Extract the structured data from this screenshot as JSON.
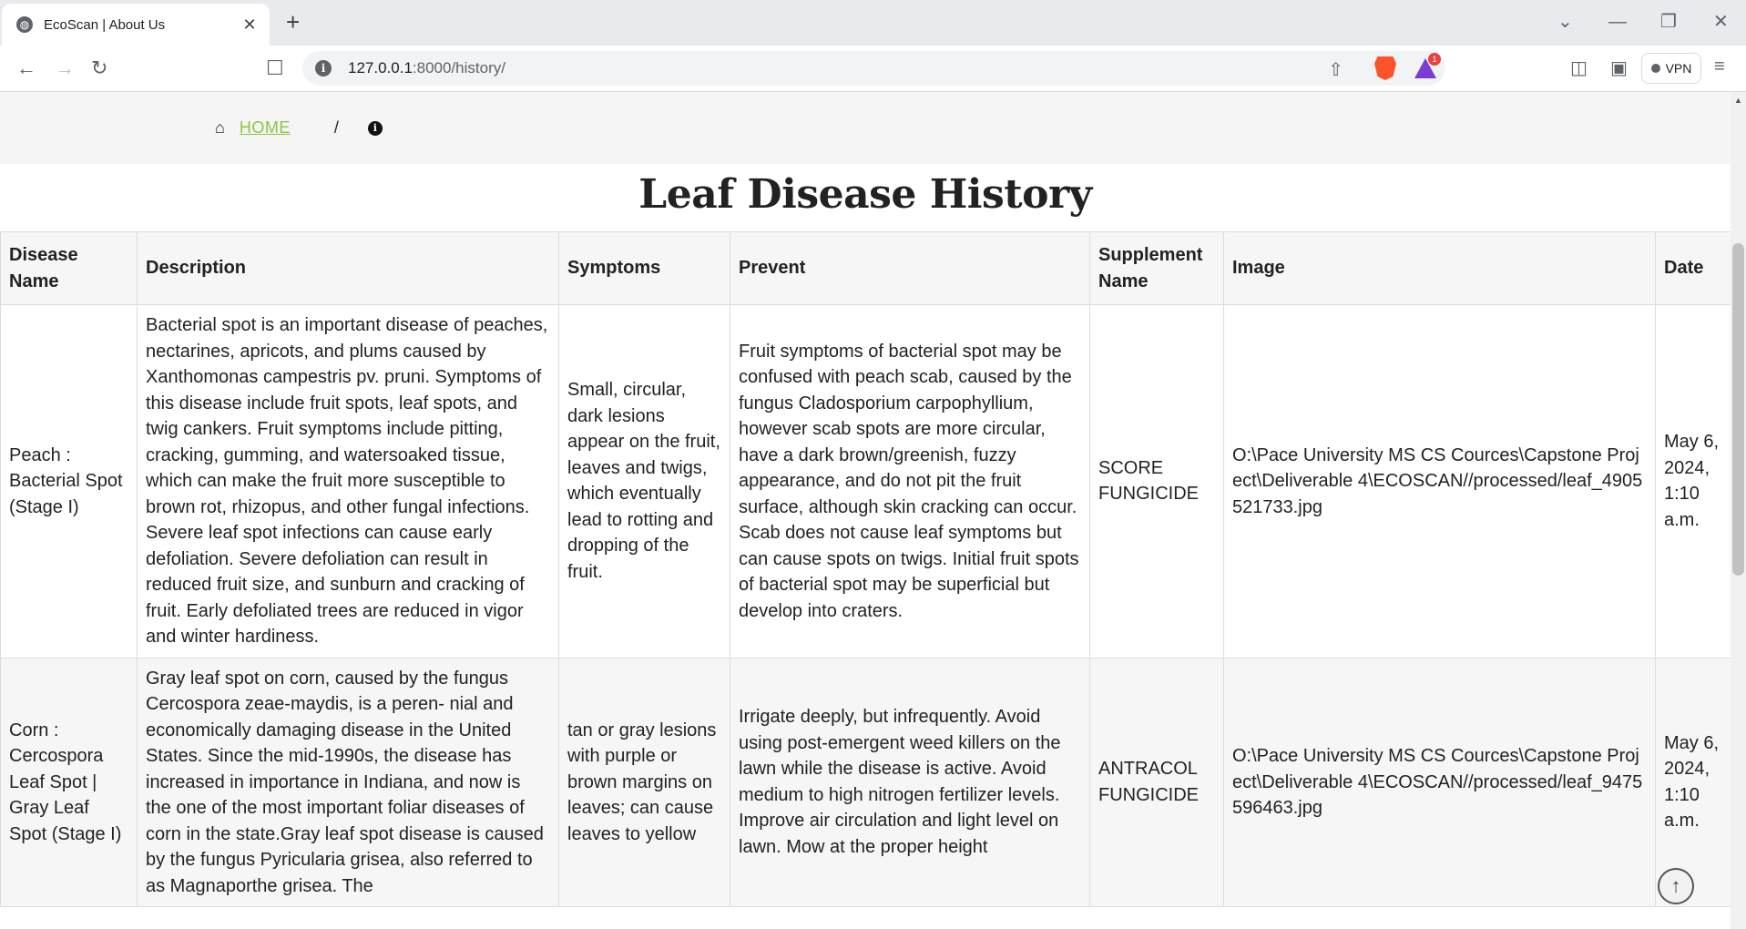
{
  "browser": {
    "tab_title": "EcoScan | About Us",
    "tab_icon": "globe-icon",
    "url_host": "127.0.0.1",
    "url_path": ":8000/history/",
    "vpn_label": "VPN",
    "bat_badge": "1"
  },
  "breadcrumb": {
    "home_label": "HOME",
    "separator": "/",
    "home_color": "#8cc63f"
  },
  "page": {
    "title": "Leaf Disease History"
  },
  "table": {
    "headers": [
      "Disease Name",
      "Description",
      "Symptoms",
      "Prevent",
      "Supplement Name",
      "Image",
      "Date"
    ],
    "rows": [
      {
        "disease_name": "Peach : Bacterial Spot (Stage I)",
        "description": "Bacterial spot is an important disease of peaches, nectarines, apricots, and plums caused by Xanthomonas campestris pv. pruni. Symptoms of this disease include fruit spots, leaf spots, and twig cankers. Fruit symptoms include pitting, cracking, gumming, and watersoaked tissue, which can make the fruit more susceptible to brown rot, rhizopus, and other fungal infections. Severe leaf spot infections can cause early defoliation. Severe defoliation can result in reduced fruit size, and sunburn and cracking of fruit. Early defoliated trees are reduced in vigor and winter hardiness.",
        "symptoms": "Small, circular, dark lesions appear on the fruit, leaves and twigs, which eventually lead to rotting and dropping of the fruit.",
        "prevent": "Fruit symptoms of bacterial spot may be confused with peach scab, caused by the fungus Cladosporium carpophyllium, however scab spots are more circular, have a dark brown/greenish, fuzzy appearance, and do not pit the fruit surface, although skin cracking can occur. Scab does not cause leaf symptoms but can cause spots on twigs. Initial fruit spots of bacterial spot may be superficial but develop into craters.",
        "supplement": "SCORE FUNGICIDE",
        "image": "O:\\Pace University MS CS Cources\\Capstone Project\\Deliverable 4\\ECOSCAN//processed/leaf_4905521733.jpg",
        "date": "May 6, 2024, 1:10 a.m."
      },
      {
        "disease_name": "Corn : Cercospora Leaf Spot | Gray Leaf Spot (Stage I)",
        "description": "Gray leaf spot on corn, caused by the fungus Cercospora zeae-maydis, is a peren- nial and economically damaging disease in the United States. Since the mid-1990s, the disease has increased in importance in Indiana, and now is the one of the most important foliar diseases of corn in the state.Gray leaf spot disease is caused by the fungus Pyricularia grisea, also referred to as Magnaporthe grisea. The",
        "symptoms": "tan or gray lesions with purple or brown margins on leaves; can cause leaves to yellow",
        "prevent": "Irrigate deeply, but infrequently. Avoid using post-emergent weed killers on the lawn while the disease is active. Avoid medium to high nitrogen fertilizer levels. Improve air circulation and light level on lawn. Mow at the proper height",
        "supplement": "ANTRACOL FUNGICIDE",
        "image": "O:\\Pace University MS CS Cources\\Capstone Project\\Deliverable 4\\ECOSCAN//processed/leaf_9475596463.jpg",
        "date": "May 6, 2024, 1:10 a.m."
      }
    ]
  }
}
